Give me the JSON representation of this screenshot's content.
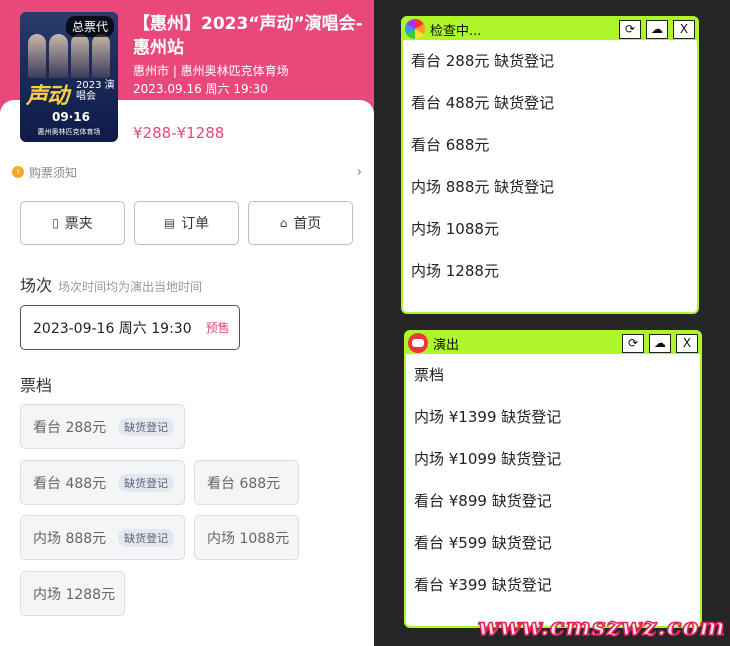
{
  "event": {
    "poster": {
      "badge": "总票代",
      "big_text": "声动",
      "year_text": "2023 演唱会",
      "date_text": "09·16",
      "venue_text": "惠州奥林匹克体育场"
    },
    "title": "【惠州】2023“声动”演唱会-惠州站",
    "location": "惠州市 | 惠州奥林匹克体育场",
    "datetime": "2023.09.16 周六 19:30",
    "price_range": "¥288-¥1288"
  },
  "notice": {
    "icon": "info-icon",
    "label": "购票须知",
    "chevron": "›"
  },
  "nav": [
    {
      "icon": "▯",
      "label": "票夹"
    },
    {
      "icon": "▤",
      "label": "订单"
    },
    {
      "icon": "⌂",
      "label": "首页"
    }
  ],
  "session": {
    "heading": "场次",
    "note": "场次时间均为演出当地时间",
    "selected": "2023-09-16 周六 19:30",
    "tag": "预售"
  },
  "tickets": {
    "heading": "票档",
    "items": [
      {
        "label": "看台 288元",
        "tag": "缺货登记"
      },
      {
        "label": "看台 488元",
        "tag": "缺货登记"
      },
      {
        "label": "看台 688元",
        "tag": ""
      },
      {
        "label": "内场 888元",
        "tag": "缺货登记"
      },
      {
        "label": "内场 1088元",
        "tag": ""
      },
      {
        "label": "内场 1288元",
        "tag": ""
      }
    ]
  },
  "window1": {
    "title": "检查中...",
    "btn_refresh": "⟳",
    "btn_cloud": "☁",
    "btn_close": "X",
    "rows": [
      "看台 288元 缺货登记",
      "看台 488元 缺货登记",
      "看台 688元",
      "内场 888元 缺货登记",
      "内场 1088元",
      "内场 1288元"
    ]
  },
  "window2": {
    "title": "演出",
    "btn_refresh": "⟳",
    "btn_cloud": "☁",
    "btn_close": "X",
    "rows": [
      "票档",
      "内场 ¥1399 缺货登记",
      "内场 ¥1099 缺货登记",
      "看台 ¥899 缺货登记",
      "看台 ¥599 缺货登记",
      "看台 ¥399 缺货登记"
    ]
  },
  "watermark": "www.cmszwz.com",
  "colors": {
    "brand": "#e8487a",
    "window_accent": "#aef52a",
    "background": "#262626"
  }
}
